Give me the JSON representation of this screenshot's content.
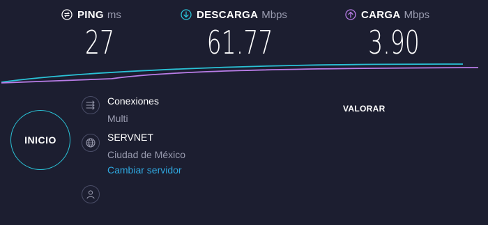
{
  "ping": {
    "label": "PING",
    "unit": "ms",
    "value": "27",
    "icon": "ping-icon"
  },
  "download": {
    "label": "DESCARGA",
    "unit": "Mbps",
    "value": "61.77",
    "icon": "download-arrow-icon",
    "color": "#2ac2d6"
  },
  "upload": {
    "label": "CARGA",
    "unit": "Mbps",
    "value": "3.90",
    "icon": "upload-arrow-icon",
    "color": "#b97de8"
  },
  "start_button": {
    "label": "INICIO"
  },
  "connections": {
    "title": "Conexiones",
    "mode": "Multi",
    "icon": "connections-icon"
  },
  "server": {
    "provider": "SERVNET",
    "location": "Ciudad de México",
    "change_link": "Cambiar servidor",
    "icon": "globe-icon"
  },
  "user": {
    "icon": "user-icon"
  },
  "rate": {
    "label": "VALORAR"
  },
  "colors": {
    "background": "#1c1e30",
    "download_line": "#2ac2d6",
    "upload_line": "#b97de8",
    "link": "#2fa8e0"
  }
}
